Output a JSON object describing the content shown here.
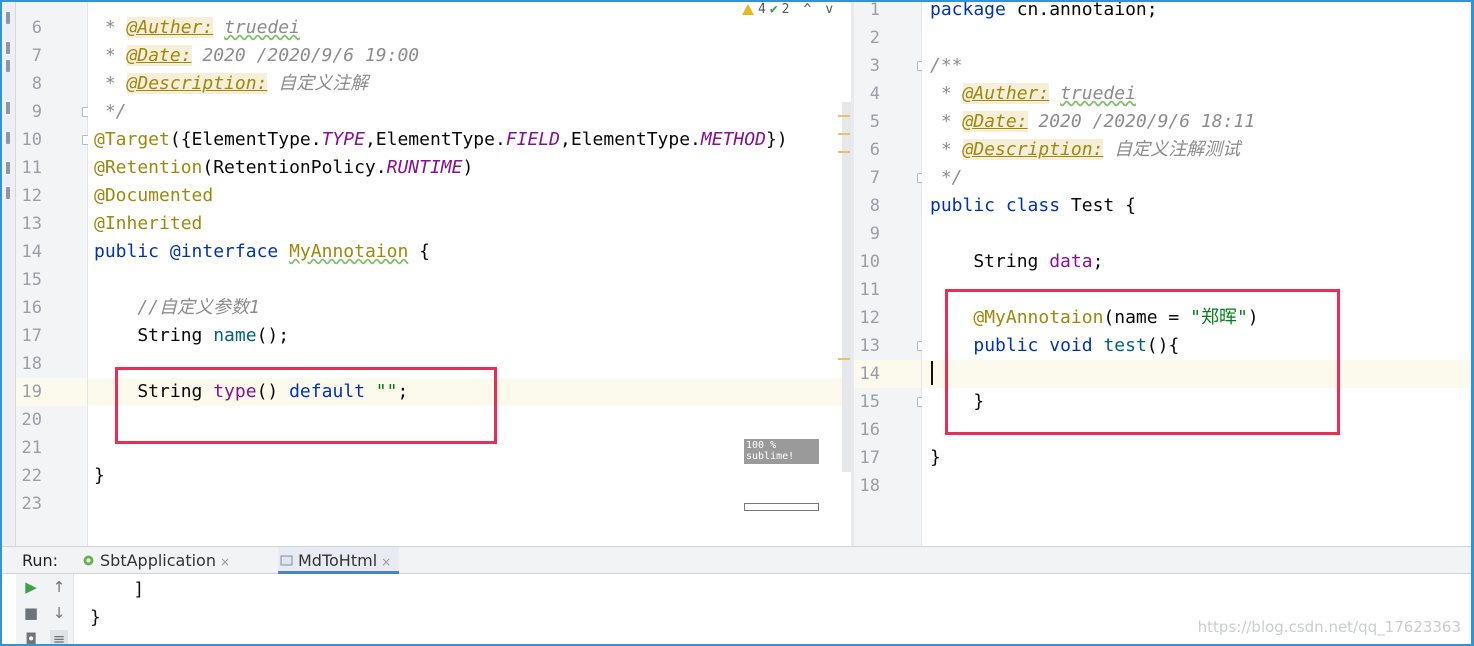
{
  "left_editor": {
    "lines": [
      {
        "n": "6",
        "segments": [
          {
            "t": " * ",
            "c": "cm"
          },
          {
            "t": "@Auther:",
            "c": "tag"
          },
          {
            "t": " ",
            "c": "cm"
          },
          {
            "t": "truedei",
            "c": "cm wavy"
          }
        ]
      },
      {
        "n": "7",
        "segments": [
          {
            "t": " * ",
            "c": "cm"
          },
          {
            "t": "@Date:",
            "c": "tag"
          },
          {
            "t": " 2020 /2020/9/6 19:00",
            "c": "cm"
          }
        ]
      },
      {
        "n": "8",
        "segments": [
          {
            "t": " * ",
            "c": "cm"
          },
          {
            "t": "@Description:",
            "c": "tag"
          },
          {
            "t": " 自定义注解",
            "c": "cm"
          }
        ]
      },
      {
        "n": "9",
        "segments": [
          {
            "t": " */",
            "c": "cm"
          }
        ]
      },
      {
        "n": "10",
        "segments": [
          {
            "t": "@Target",
            "c": "ann"
          },
          {
            "t": "({ElementType.",
            "c": ""
          },
          {
            "t": "TYPE",
            "c": "st"
          },
          {
            "t": ",ElementType.",
            "c": ""
          },
          {
            "t": "FIELD",
            "c": "st"
          },
          {
            "t": ",ElementType.",
            "c": ""
          },
          {
            "t": "METHOD",
            "c": "st"
          },
          {
            "t": "})",
            "c": ""
          }
        ]
      },
      {
        "n": "11",
        "segments": [
          {
            "t": "@Retention",
            "c": "ann"
          },
          {
            "t": "(RetentionPolicy.",
            "c": ""
          },
          {
            "t": "RUNTIME",
            "c": "st"
          },
          {
            "t": ")",
            "c": ""
          }
        ]
      },
      {
        "n": "12",
        "segments": [
          {
            "t": "@Documented",
            "c": "ann"
          }
        ]
      },
      {
        "n": "13",
        "segments": [
          {
            "t": "@Inherited",
            "c": "ann"
          }
        ]
      },
      {
        "n": "14",
        "segments": [
          {
            "t": "public",
            "c": "kw"
          },
          {
            "t": " ",
            "c": ""
          },
          {
            "t": "@interface",
            "c": "kw"
          },
          {
            "t": " ",
            "c": ""
          },
          {
            "t": "MyAnnotaion",
            "c": "ann wavy"
          },
          {
            "t": " {",
            "c": ""
          }
        ]
      },
      {
        "n": "15",
        "segments": []
      },
      {
        "n": "16",
        "segments": [
          {
            "t": "    //自定义参数1",
            "c": "cm"
          }
        ]
      },
      {
        "n": "17",
        "segments": [
          {
            "t": "    String ",
            "c": ""
          },
          {
            "t": "name",
            "c": "fn"
          },
          {
            "t": "();",
            "c": ""
          }
        ]
      },
      {
        "n": "18",
        "segments": []
      },
      {
        "n": "19",
        "segments": [
          {
            "t": "    String ",
            "c": ""
          },
          {
            "t": "type",
            "c": "grey"
          },
          {
            "t": "() ",
            "c": ""
          },
          {
            "t": "default",
            "c": "kw"
          },
          {
            "t": " ",
            "c": ""
          },
          {
            "t": "\"\"",
            "c": "str"
          },
          {
            "t": ";",
            "c": ""
          }
        ]
      },
      {
        "n": "20",
        "segments": []
      },
      {
        "n": "21",
        "segments": []
      },
      {
        "n": "22",
        "segments": [
          {
            "t": "}",
            "c": ""
          }
        ]
      },
      {
        "n": "23",
        "segments": []
      }
    ],
    "inspections": {
      "warnings": "4",
      "ok": "2"
    },
    "minimap_badge": "100 %\nsublime!"
  },
  "right_editor": {
    "lines": [
      {
        "n": "1",
        "segments": [
          {
            "t": "package",
            "c": "kw"
          },
          {
            "t": " cn.annotaion;",
            "c": ""
          }
        ]
      },
      {
        "n": "2",
        "segments": []
      },
      {
        "n": "3",
        "segments": [
          {
            "t": "/**",
            "c": "cm"
          }
        ]
      },
      {
        "n": "4",
        "segments": [
          {
            "t": " * ",
            "c": "cm"
          },
          {
            "t": "@Auther:",
            "c": "tag"
          },
          {
            "t": " ",
            "c": "cm"
          },
          {
            "t": "truedei",
            "c": "cm wavy"
          }
        ]
      },
      {
        "n": "5",
        "segments": [
          {
            "t": " * ",
            "c": "cm"
          },
          {
            "t": "@Date:",
            "c": "tag"
          },
          {
            "t": " 2020 /2020/9/6 18:11",
            "c": "cm"
          }
        ]
      },
      {
        "n": "6",
        "segments": [
          {
            "t": " * ",
            "c": "cm"
          },
          {
            "t": "@Description:",
            "c": "tag"
          },
          {
            "t": " 自定义注解测试",
            "c": "cm"
          }
        ]
      },
      {
        "n": "7",
        "segments": [
          {
            "t": " */",
            "c": "cm"
          }
        ]
      },
      {
        "n": "8",
        "segments": [
          {
            "t": "public",
            "c": "kw"
          },
          {
            "t": " ",
            "c": ""
          },
          {
            "t": "class",
            "c": "kw"
          },
          {
            "t": " Test {",
            "c": ""
          }
        ]
      },
      {
        "n": "9",
        "segments": []
      },
      {
        "n": "10",
        "segments": [
          {
            "t": "    String ",
            "c": ""
          },
          {
            "t": "data",
            "c": "grey"
          },
          {
            "t": ";",
            "c": ""
          }
        ]
      },
      {
        "n": "11",
        "segments": []
      },
      {
        "n": "12",
        "segments": [
          {
            "t": "    ",
            "c": ""
          },
          {
            "t": "@MyAnnotaion",
            "c": "ann"
          },
          {
            "t": "(name = ",
            "c": ""
          },
          {
            "t": "\"郑晖\"",
            "c": "str"
          },
          {
            "t": ")",
            "c": ""
          }
        ]
      },
      {
        "n": "13",
        "segments": [
          {
            "t": "    ",
            "c": ""
          },
          {
            "t": "public",
            "c": "kw"
          },
          {
            "t": " ",
            "c": ""
          },
          {
            "t": "void",
            "c": "kw"
          },
          {
            "t": " ",
            "c": ""
          },
          {
            "t": "test",
            "c": "fn"
          },
          {
            "t": "(){",
            "c": ""
          }
        ]
      },
      {
        "n": "14",
        "segments": []
      },
      {
        "n": "15",
        "segments": [
          {
            "t": "    }",
            "c": ""
          }
        ]
      },
      {
        "n": "16",
        "segments": []
      },
      {
        "n": "17",
        "segments": [
          {
            "t": "}",
            "c": ""
          }
        ]
      },
      {
        "n": "18",
        "segments": []
      }
    ]
  },
  "run_panel": {
    "label": "Run:",
    "tabs": [
      {
        "label": "SbtApplication",
        "active": false
      },
      {
        "label": "MdToHtml",
        "active": true
      }
    ],
    "console_lines": [
      "    ]",
      "}"
    ]
  },
  "watermark": "https://blog.csdn.net/qq_17623363",
  "colors": {
    "highlight_box": "#ee2b55",
    "frame": "#2f95d6",
    "current_line": "#fcfaed"
  }
}
